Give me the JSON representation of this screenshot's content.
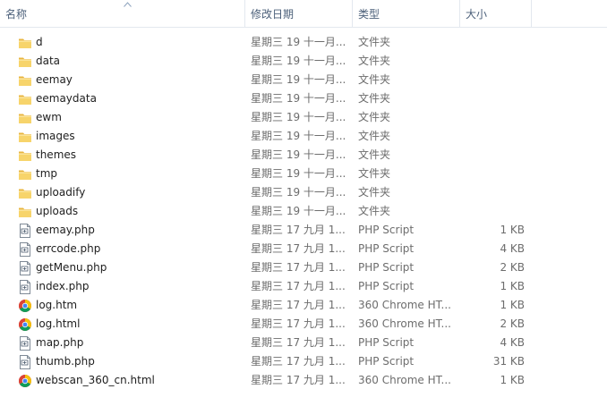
{
  "columns": {
    "name": "名称",
    "modified": "修改日期",
    "type": "类型",
    "size": "大小"
  },
  "files": [
    {
      "name": "d",
      "modified": "星期三 19 十一月...",
      "type": "文件夹",
      "size": "",
      "icon": "folder-icon"
    },
    {
      "name": "data",
      "modified": "星期三 19 十一月...",
      "type": "文件夹",
      "size": "",
      "icon": "folder-icon"
    },
    {
      "name": "eemay",
      "modified": "星期三 19 十一月...",
      "type": "文件夹",
      "size": "",
      "icon": "folder-icon"
    },
    {
      "name": "eemaydata",
      "modified": "星期三 19 十一月...",
      "type": "文件夹",
      "size": "",
      "icon": "folder-icon"
    },
    {
      "name": "ewm",
      "modified": "星期三 19 十一月...",
      "type": "文件夹",
      "size": "",
      "icon": "folder-icon"
    },
    {
      "name": "images",
      "modified": "星期三 19 十一月...",
      "type": "文件夹",
      "size": "",
      "icon": "folder-icon"
    },
    {
      "name": "themes",
      "modified": "星期三 19 十一月...",
      "type": "文件夹",
      "size": "",
      "icon": "folder-icon"
    },
    {
      "name": "tmp",
      "modified": "星期三 19 十一月...",
      "type": "文件夹",
      "size": "",
      "icon": "folder-icon"
    },
    {
      "name": "uploadify",
      "modified": "星期三 19 十一月...",
      "type": "文件夹",
      "size": "",
      "icon": "folder-icon"
    },
    {
      "name": "uploads",
      "modified": "星期三 19 十一月...",
      "type": "文件夹",
      "size": "",
      "icon": "folder-icon"
    },
    {
      "name": "eemay.php",
      "modified": "星期三 17 九月 1...",
      "type": "PHP Script",
      "size": "1 KB",
      "icon": "php-file-icon"
    },
    {
      "name": "errcode.php",
      "modified": "星期三 17 九月 1...",
      "type": "PHP Script",
      "size": "4 KB",
      "icon": "php-file-icon"
    },
    {
      "name": "getMenu.php",
      "modified": "星期三 17 九月 1...",
      "type": "PHP Script",
      "size": "2 KB",
      "icon": "php-file-icon"
    },
    {
      "name": "index.php",
      "modified": "星期三 17 九月 1...",
      "type": "PHP Script",
      "size": "1 KB",
      "icon": "php-file-icon"
    },
    {
      "name": "log.htm",
      "modified": "星期三 17 九月 1...",
      "type": "360 Chrome HT...",
      "size": "1 KB",
      "icon": "chrome-html-icon"
    },
    {
      "name": "log.html",
      "modified": "星期三 17 九月 1...",
      "type": "360 Chrome HT...",
      "size": "2 KB",
      "icon": "chrome-html-icon"
    },
    {
      "name": "map.php",
      "modified": "星期三 17 九月 1...",
      "type": "PHP Script",
      "size": "4 KB",
      "icon": "php-file-icon"
    },
    {
      "name": "thumb.php",
      "modified": "星期三 17 九月 1...",
      "type": "PHP Script",
      "size": "31 KB",
      "icon": "php-file-icon"
    },
    {
      "name": "webscan_360_cn.html",
      "modified": "星期三 17 九月 1...",
      "type": "360 Chrome HT...",
      "size": "1 KB",
      "icon": "chrome-html-icon"
    }
  ]
}
